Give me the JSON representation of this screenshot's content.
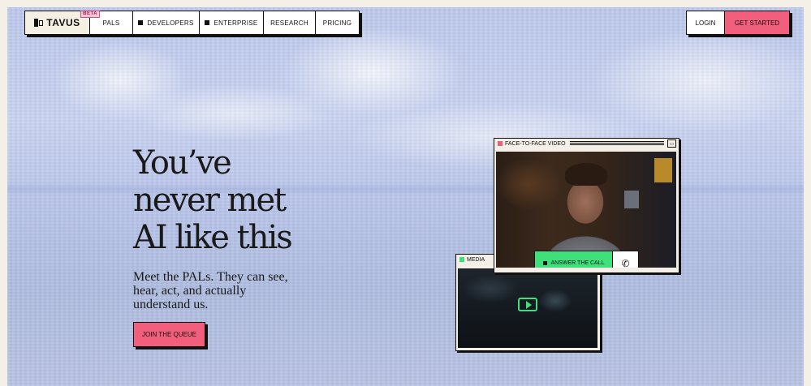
{
  "nav": {
    "logo": "TAVUS",
    "beta": "BETA",
    "items": [
      {
        "label": "PALS",
        "icon": ""
      },
      {
        "label": "DEVELOPERS",
        "icon": "square-icon"
      },
      {
        "label": "ENTERPRISE",
        "icon": "square-icon"
      },
      {
        "label": "RESEARCH",
        "icon": ""
      },
      {
        "label": "PRICING",
        "icon": ""
      }
    ],
    "login": "LOGIN",
    "get_started": "GET STARTED"
  },
  "hero": {
    "headline": [
      "You’ve",
      "never met",
      "AI like this"
    ],
    "subtext": "Meet the PALs. They can see, hear, act, and actually understand us.",
    "cta": "JOIN THE QUEUE"
  },
  "video_window": {
    "title": "FACE-TO-FACE VIDEO",
    "answer_button": "ANSWER THE CALL",
    "phone_icon": "phone-icon",
    "accent": "#f25f7c"
  },
  "media_window": {
    "title": "MEDIA",
    "play_icon": "play-icon",
    "accent": "#3fe07a"
  },
  "colors": {
    "brand_pink": "#f25f7c",
    "green": "#3fe07a",
    "ink": "#111111"
  }
}
